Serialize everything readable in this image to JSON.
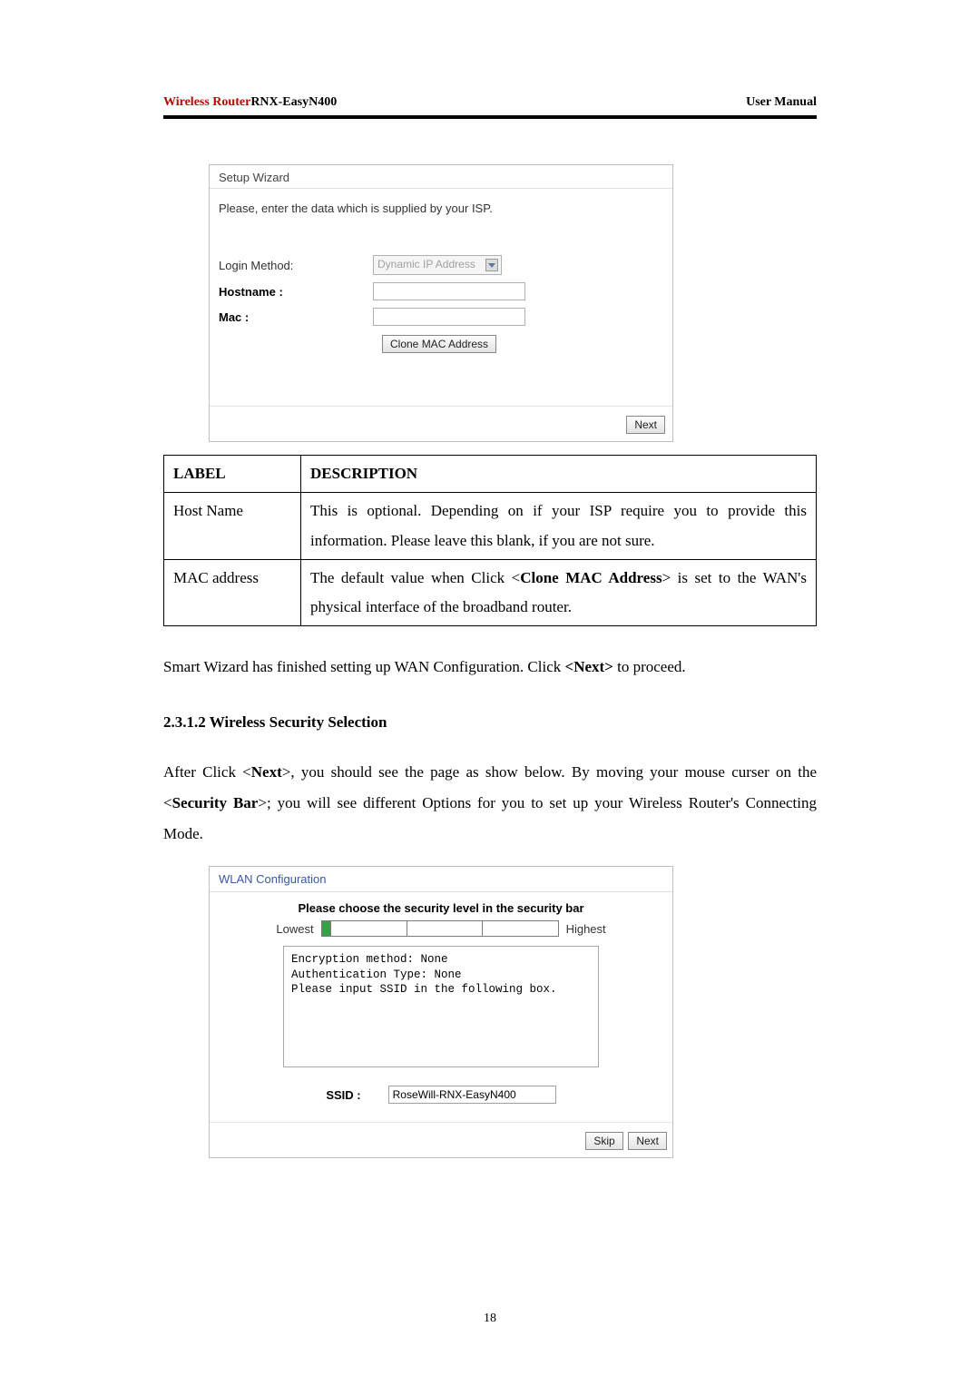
{
  "header": {
    "left_red": "Wireless Router",
    "left_bold": "RNX-EasyN400",
    "right": "User Manual"
  },
  "wizard1": {
    "title": "Setup Wizard",
    "prompt": "Please, enter the data which is supplied by your ISP.",
    "login_method_label": "Login Method:",
    "login_method_value": "Dynamic IP Address",
    "hostname_label": "Hostname :",
    "hostname_value": "",
    "mac_label": "Mac :",
    "mac_value": "",
    "clone_button": "Clone MAC Address",
    "next_button": "Next"
  },
  "table": {
    "head_label": "LABEL",
    "head_desc": "DESCRIPTION",
    "rows": [
      {
        "label": "Host Name",
        "desc": "This is optional. Depending on if your ISP require you to provide this information. Please leave this blank, if you are not sure."
      },
      {
        "label": "MAC address",
        "desc_pre": "The default value when Click <",
        "desc_bold": "Clone MAC Address",
        "desc_post": "> is set to the WAN's physical interface of the broadband router."
      }
    ]
  },
  "body": {
    "wan_done_pre": "Smart Wizard has finished setting up WAN Configuration. Click ",
    "wan_done_bold": "<Next>",
    "wan_done_post": " to proceed.",
    "section_title": "2.3.1.2 Wireless Security Selection",
    "para_pre": "After Click <",
    "para_b1": "Next",
    "para_mid1": ">, you should see the page as show below. By moving your mouse curser on the <",
    "para_b2": "Security Bar",
    "para_mid2": ">; you will see different Options for you to set up your Wireless Router's Connecting Mode."
  },
  "wizard2": {
    "title": "WLAN Configuration",
    "prompt": "Please choose the security level in the security bar",
    "lowest": "Lowest",
    "highest": "Highest",
    "info_line1": "Encryption method: None",
    "info_line2": "Authentication Type: None",
    "info_line3": "Please input SSID in the following box.",
    "ssid_label": "SSID :",
    "ssid_value": "RoseWill-RNX-EasyN400",
    "skip_button": "Skip",
    "next_button": "Next"
  },
  "page_number": "18"
}
